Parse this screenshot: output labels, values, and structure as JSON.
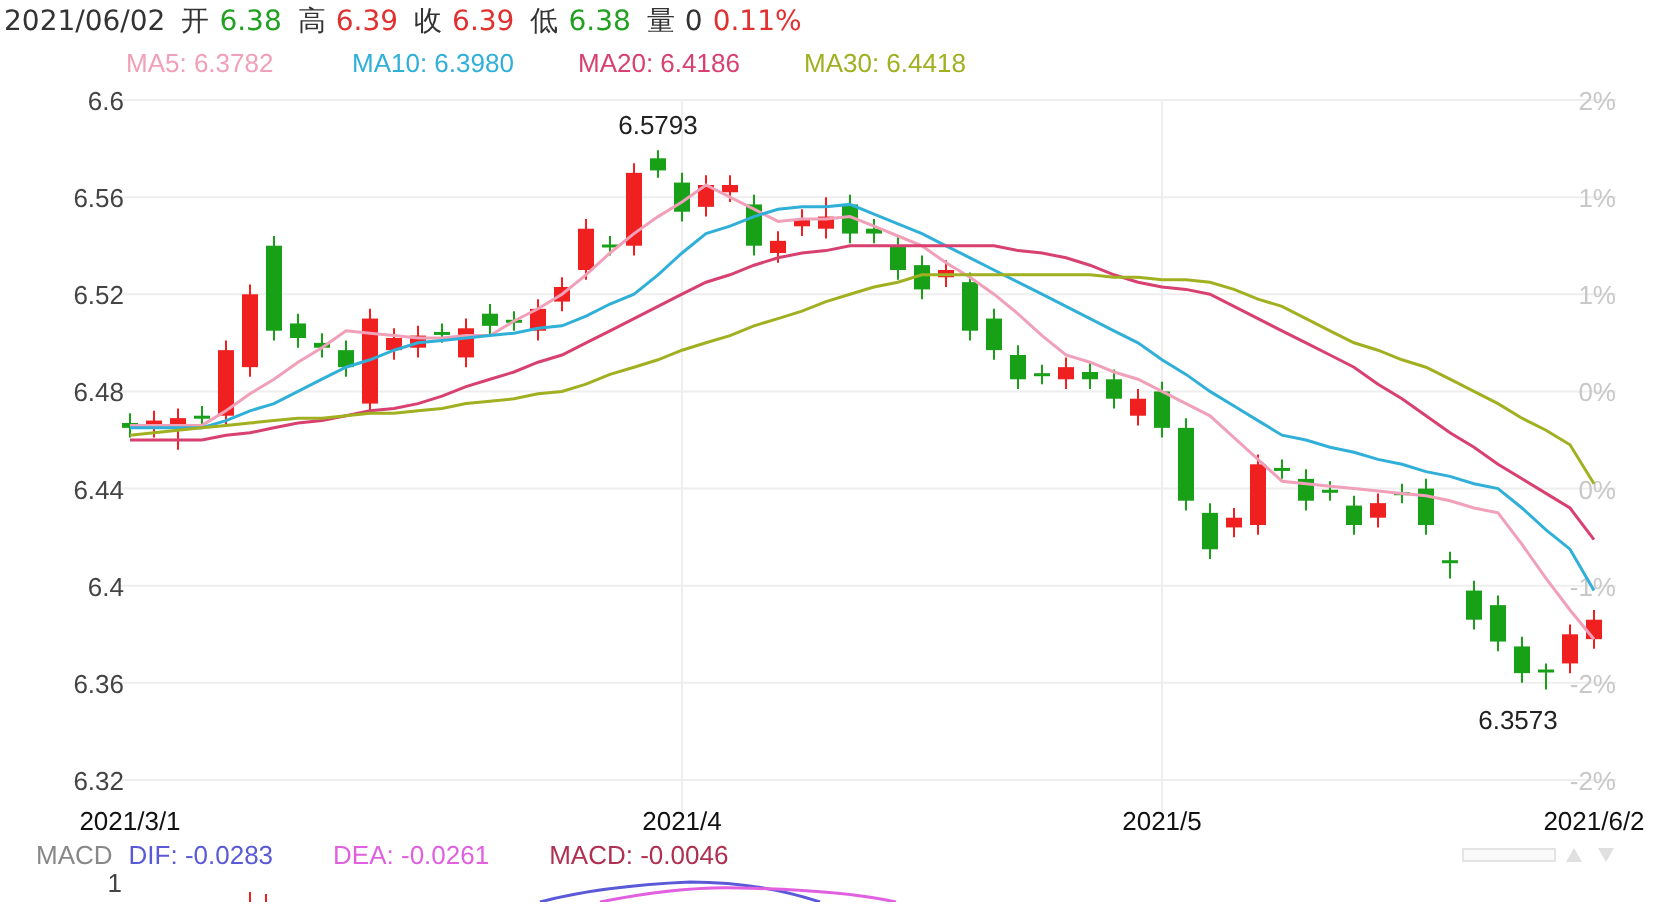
{
  "quote": {
    "date": "2021/06/02",
    "items": [
      {
        "label": "开",
        "value": "6.38",
        "color": "#22a022"
      },
      {
        "label": "高",
        "value": "6.39",
        "color": "#e03030"
      },
      {
        "label": "收",
        "value": "6.39",
        "color": "#e03030"
      },
      {
        "label": "低",
        "value": "6.38",
        "color": "#22a022"
      },
      {
        "label": "量",
        "value": "0",
        "color": "#333333"
      }
    ],
    "change": {
      "value": "0.11%",
      "color": "#e03030"
    }
  },
  "legend": [
    {
      "label": "MA5: 6.3782",
      "color": "#f0a0b8"
    },
    {
      "label": "MA10: 6.3980",
      "color": "#30b0d8"
    },
    {
      "label": "MA20: 6.4186",
      "color": "#d84070"
    },
    {
      "label": "MA30: 6.4418",
      "color": "#a0b020"
    }
  ],
  "percent_axis": [
    "2%",
    "1%",
    "1%",
    "0%",
    "0%",
    "-1%",
    "-2%",
    "-2%"
  ],
  "chart_data": {
    "type": "candlestick",
    "categories": [
      "2021/3/1",
      null,
      null,
      null,
      null,
      null,
      null,
      null,
      null,
      null,
      null,
      null,
      null,
      null,
      null,
      null,
      null,
      null,
      null,
      null,
      null,
      null,
      null,
      "2021/4",
      null,
      null,
      null,
      null,
      null,
      null,
      null,
      null,
      null,
      null,
      null,
      null,
      null,
      null,
      null,
      null,
      null,
      null,
      null,
      "2021/5",
      null,
      null,
      null,
      null,
      null,
      null,
      null,
      null,
      null,
      null,
      null,
      null,
      null,
      null,
      null,
      null,
      null,
      "2021/6/2"
    ],
    "ylim": [
      6.32,
      6.6
    ],
    "grid": true,
    "yticks": [
      6.32,
      6.36,
      6.4,
      6.44,
      6.48,
      6.52,
      6.56,
      6.6
    ],
    "ohlc": [
      [
        6.467,
        6.471,
        6.461,
        6.465
      ],
      [
        6.465,
        6.472,
        6.461,
        6.468
      ],
      [
        6.466,
        6.473,
        6.456,
        6.469
      ],
      [
        6.47,
        6.474,
        6.465,
        6.469
      ],
      [
        6.47,
        6.501,
        6.466,
        6.497
      ],
      [
        6.49,
        6.524,
        6.486,
        6.52
      ],
      [
        6.54,
        6.544,
        6.501,
        6.505
      ],
      [
        6.508,
        6.512,
        6.498,
        6.502
      ],
      [
        6.5,
        6.504,
        6.494,
        6.498
      ],
      [
        6.497,
        6.501,
        6.486,
        6.49
      ],
      [
        6.475,
        6.514,
        6.471,
        6.51
      ],
      [
        6.497,
        6.506,
        6.493,
        6.502
      ],
      [
        6.498,
        6.507,
        6.494,
        6.503
      ],
      [
        6.5045,
        6.508,
        6.5,
        6.5035
      ],
      [
        6.494,
        6.51,
        6.49,
        6.506
      ],
      [
        6.512,
        6.516,
        6.503,
        6.507
      ],
      [
        6.5095,
        6.513,
        6.505,
        6.5085
      ],
      [
        6.505,
        6.518,
        6.501,
        6.514
      ],
      [
        6.517,
        6.527,
        6.513,
        6.523
      ],
      [
        6.53,
        6.551,
        6.526,
        6.547
      ],
      [
        6.5405,
        6.544,
        6.536,
        6.5395
      ],
      [
        6.54,
        6.574,
        6.536,
        6.57
      ],
      [
        6.576,
        6.5793,
        6.568,
        6.571
      ],
      [
        6.566,
        6.57,
        6.55,
        6.554
      ],
      [
        6.556,
        6.569,
        6.552,
        6.565
      ],
      [
        6.562,
        6.569,
        6.558,
        6.565
      ],
      [
        6.557,
        6.561,
        6.536,
        6.54
      ],
      [
        6.537,
        6.546,
        6.533,
        6.542
      ],
      [
        6.548,
        6.555,
        6.544,
        6.551
      ],
      [
        6.547,
        6.56,
        6.543,
        6.552
      ],
      [
        6.557,
        6.561,
        6.541,
        6.545
      ],
      [
        6.547,
        6.551,
        6.541,
        6.545
      ],
      [
        6.54,
        6.544,
        6.526,
        6.53
      ],
      [
        6.532,
        6.536,
        6.518,
        6.522
      ],
      [
        6.527,
        6.534,
        6.523,
        6.53
      ],
      [
        6.525,
        6.529,
        6.501,
        6.505
      ],
      [
        6.51,
        6.514,
        6.493,
        6.497
      ],
      [
        6.495,
        6.499,
        6.481,
        6.485
      ],
      [
        6.4875,
        6.491,
        6.483,
        6.4865
      ],
      [
        6.485,
        6.494,
        6.481,
        6.49
      ],
      [
        6.488,
        6.492,
        6.481,
        6.485
      ],
      [
        6.485,
        6.489,
        6.473,
        6.477
      ],
      [
        6.47,
        6.481,
        6.466,
        6.477
      ],
      [
        6.48,
        6.484,
        6.461,
        6.465
      ],
      [
        6.465,
        6.469,
        6.431,
        6.435
      ],
      [
        6.43,
        6.434,
        6.411,
        6.415
      ],
      [
        6.424,
        6.432,
        6.42,
        6.428
      ],
      [
        6.425,
        6.454,
        6.421,
        6.45
      ],
      [
        6.4485,
        6.452,
        6.444,
        6.4475
      ],
      [
        6.444,
        6.448,
        6.431,
        6.435
      ],
      [
        6.4395,
        6.443,
        6.435,
        6.4385
      ],
      [
        6.433,
        6.437,
        6.421,
        6.425
      ],
      [
        6.428,
        6.438,
        6.424,
        6.434
      ],
      [
        6.4385,
        6.442,
        6.434,
        6.4375
      ],
      [
        6.44,
        6.444,
        6.421,
        6.425
      ],
      [
        6.4105,
        6.414,
        6.403,
        6.4095
      ],
      [
        6.398,
        6.402,
        6.382,
        6.386
      ],
      [
        6.392,
        6.396,
        6.373,
        6.377
      ],
      [
        6.375,
        6.379,
        6.36,
        6.364
      ],
      [
        6.3655,
        6.368,
        6.3573,
        6.3645
      ],
      [
        6.368,
        6.384,
        6.364,
        6.38
      ],
      [
        6.378,
        6.39,
        6.374,
        6.386
      ]
    ],
    "series": [
      {
        "type": "line",
        "color": "#f0a0b8",
        "values": [
          6.466,
          6.466,
          6.466,
          6.466,
          6.472,
          6.479,
          6.485,
          6.492,
          6.498,
          6.505,
          6.504,
          6.503,
          6.502,
          6.502,
          6.503,
          6.503,
          6.509,
          6.514,
          6.52,
          6.528,
          6.537,
          6.545,
          6.552,
          6.558,
          6.565,
          6.56,
          6.555,
          6.55,
          6.551,
          6.551,
          6.552,
          6.548,
          6.544,
          6.54,
          6.533,
          6.527,
          6.52,
          6.512,
          6.503,
          6.495,
          6.492,
          6.488,
          6.485,
          6.48,
          6.475,
          6.47,
          6.461,
          6.452,
          6.443,
          6.442,
          6.441,
          6.44,
          6.439,
          6.438,
          6.437,
          6.435,
          6.432,
          6.43,
          6.417,
          6.403,
          6.39,
          6.378
        ]
      },
      {
        "type": "line",
        "color": "#30b0d8",
        "values": [
          6.465,
          6.465,
          6.465,
          6.465,
          6.468,
          6.472,
          6.475,
          6.48,
          6.485,
          6.49,
          6.493,
          6.497,
          6.5,
          6.501,
          6.502,
          6.503,
          6.504,
          6.506,
          6.507,
          6.511,
          6.516,
          6.52,
          6.528,
          6.537,
          6.545,
          6.548,
          6.552,
          6.555,
          6.556,
          6.556,
          6.557,
          6.553,
          6.549,
          6.545,
          6.54,
          6.535,
          6.53,
          6.525,
          6.52,
          6.515,
          6.51,
          6.505,
          6.5,
          6.493,
          6.487,
          6.48,
          6.474,
          6.468,
          6.462,
          6.46,
          6.457,
          6.455,
          6.452,
          6.45,
          6.447,
          6.445,
          6.442,
          6.44,
          6.432,
          6.423,
          6.415,
          6.398
        ]
      },
      {
        "type": "line",
        "color": "#d84070",
        "values": [
          6.46,
          6.46,
          6.46,
          6.46,
          6.462,
          6.463,
          6.465,
          6.467,
          6.468,
          6.47,
          6.472,
          6.473,
          6.475,
          6.478,
          6.482,
          6.485,
          6.488,
          6.492,
          6.495,
          6.5,
          6.505,
          6.51,
          6.515,
          6.52,
          6.525,
          6.528,
          6.532,
          6.535,
          6.537,
          6.538,
          6.54,
          6.54,
          6.54,
          6.54,
          6.54,
          6.54,
          6.54,
          6.538,
          6.537,
          6.535,
          6.532,
          6.528,
          6.525,
          6.523,
          6.522,
          6.52,
          6.515,
          6.51,
          6.505,
          6.5,
          6.495,
          6.49,
          6.483,
          6.477,
          6.47,
          6.463,
          6.457,
          6.45,
          6.444,
          6.438,
          6.432,
          6.419
        ]
      },
      {
        "type": "line",
        "color": "#a0b020",
        "values": [
          6.462,
          6.463,
          6.464,
          6.465,
          6.466,
          6.467,
          6.468,
          6.469,
          6.469,
          6.47,
          6.471,
          6.471,
          6.472,
          6.473,
          6.475,
          6.476,
          6.477,
          6.479,
          6.48,
          6.483,
          6.487,
          6.49,
          6.493,
          6.497,
          6.5,
          6.503,
          6.507,
          6.51,
          6.513,
          6.517,
          6.52,
          6.523,
          6.525,
          6.528,
          6.528,
          6.528,
          6.528,
          6.528,
          6.528,
          6.528,
          6.528,
          6.527,
          6.527,
          6.526,
          6.526,
          6.525,
          6.522,
          6.518,
          6.515,
          6.51,
          6.505,
          6.5,
          6.497,
          6.493,
          6.49,
          6.485,
          6.48,
          6.475,
          6.469,
          6.464,
          6.458,
          6.442
        ]
      }
    ],
    "annotations": [
      "6.5793",
      "6.3573"
    ]
  },
  "macd": {
    "title": "MACD",
    "items": [
      {
        "label": "DIF: -0.0283",
        "color": "#5a5ad8"
      },
      {
        "label": "DEA: -0.0261",
        "color": "#e060e0"
      },
      {
        "label": "MACD: -0.0046",
        "color": "#b03050"
      }
    ],
    "axis_label": "1"
  }
}
